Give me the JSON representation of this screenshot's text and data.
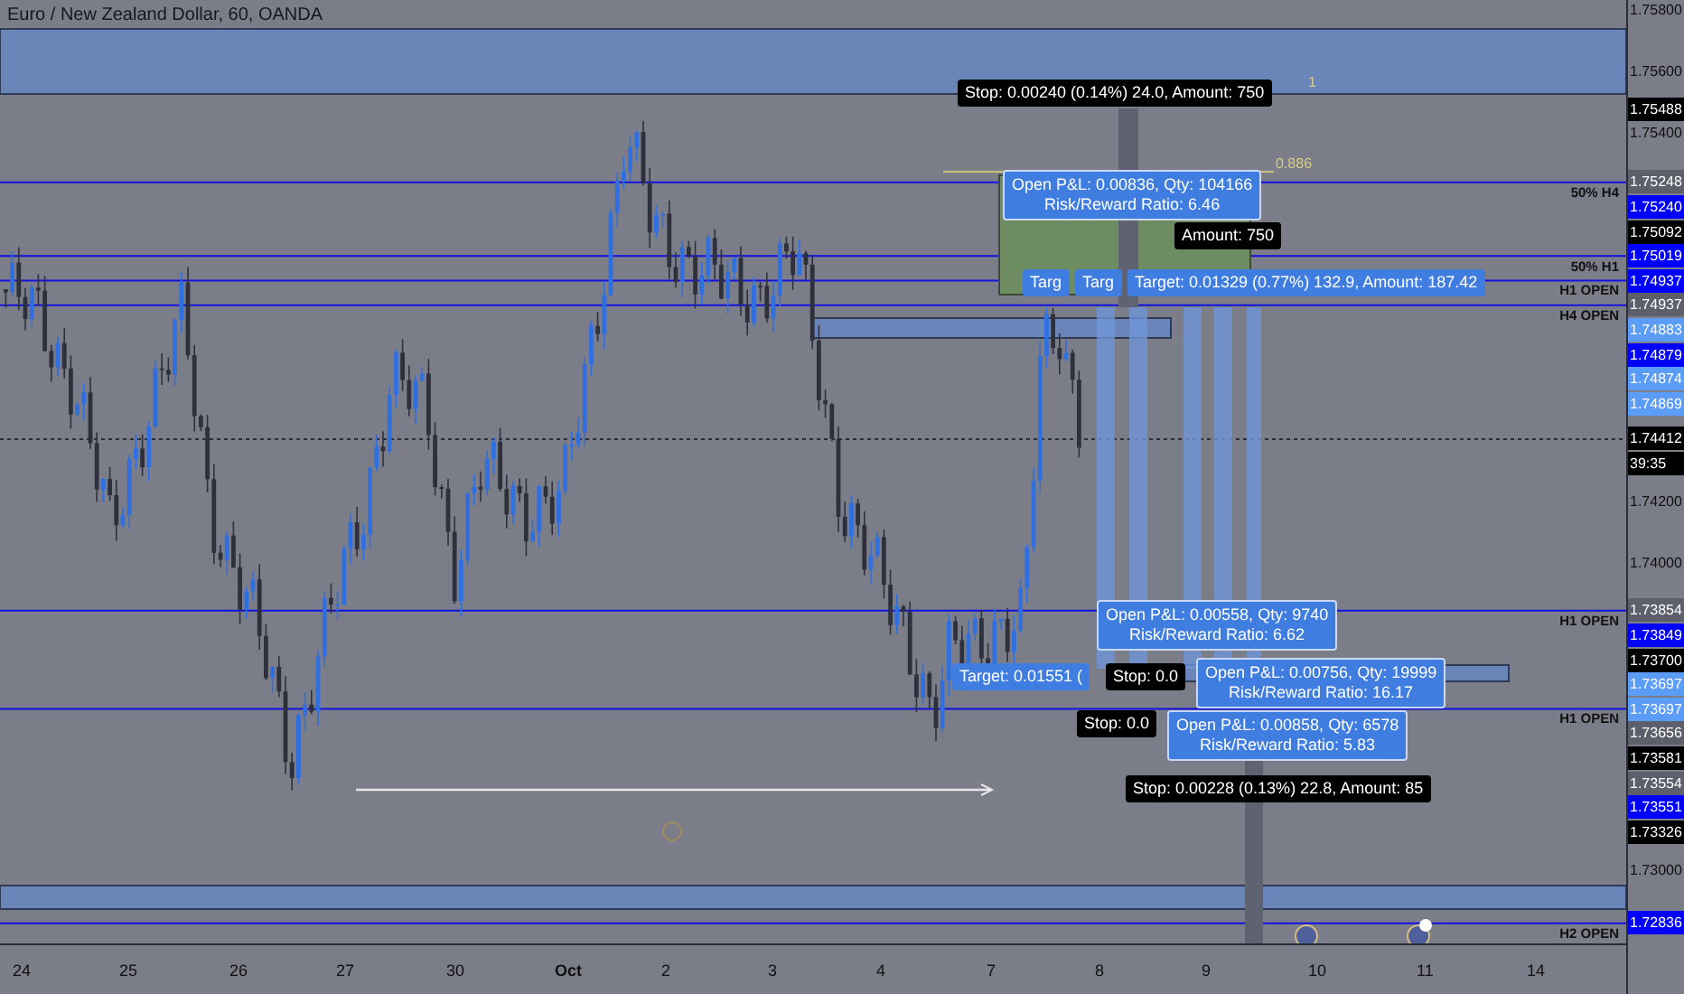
{
  "title": "Euro / New Zealand Dollar, 60, OANDA",
  "price_ticks": [
    "1.75800",
    "1.75600",
    "1.75400",
    "1.74200",
    "1.74000",
    "1.73000"
  ],
  "price_tags": [
    {
      "text": "1.75488",
      "kind": "black"
    },
    {
      "text": "1.75248",
      "kind": "grey",
      "line_label": "50% H4"
    },
    {
      "text": "1.75240",
      "kind": "blue"
    },
    {
      "text": "1.75092",
      "kind": "black"
    },
    {
      "text": "1.75019",
      "kind": "blue",
      "line_label": "50% H1"
    },
    {
      "text": "1.74937",
      "kind": "blue",
      "line_label": "H1 OPEN"
    },
    {
      "text": "1.74937",
      "kind": "grey",
      "line_label": "H4 OPEN"
    },
    {
      "text": "1.74883",
      "kind": "light"
    },
    {
      "text": "1.74879",
      "kind": "blue"
    },
    {
      "text": "1.74874",
      "kind": "light"
    },
    {
      "text": "1.74869",
      "kind": "light"
    },
    {
      "text": "1.74412",
      "kind": "black"
    },
    {
      "text": "39:35",
      "kind": "black"
    },
    {
      "text": "1.73854",
      "kind": "grey",
      "line_label": "H1 OPEN"
    },
    {
      "text": "1.73849",
      "kind": "blue"
    },
    {
      "text": "1.73700",
      "kind": "black"
    },
    {
      "text": "1.73697",
      "kind": "light"
    },
    {
      "text": "1.73697",
      "kind": "light",
      "line_label": "H1 OPEN"
    },
    {
      "text": "1.73656",
      "kind": "grey"
    },
    {
      "text": "1.73581",
      "kind": "black"
    },
    {
      "text": "1.73554",
      "kind": "grey"
    },
    {
      "text": "1.73551",
      "kind": "blue"
    },
    {
      "text": "1.73326",
      "kind": "black"
    },
    {
      "text": "1.72836",
      "kind": "blue",
      "line_label": "H2 OPEN"
    }
  ],
  "time_axis": [
    "24",
    "25",
    "26",
    "27",
    "30",
    "Oct",
    "2",
    "3",
    "4",
    "7",
    "8",
    "9",
    "10",
    "11",
    "14"
  ],
  "fib_labels": [
    "1",
    "0.886"
  ],
  "position_labels": [
    {
      "kind": "stop",
      "lines": [
        "Stop: 0.00240 (0.14%) 24.0, Amount: 750"
      ]
    },
    {
      "kind": "pnl",
      "lines": [
        "Open P&L: 0.00836, Qty: 104166",
        "Risk/Reward Ratio: 6.46"
      ]
    },
    {
      "kind": "stop",
      "lines": [
        "Amount: 750"
      ]
    },
    {
      "kind": "target",
      "lines": [
        "Targ"
      ]
    },
    {
      "kind": "target",
      "lines": [
        "Targ"
      ]
    },
    {
      "kind": "target",
      "lines": [
        "Target: 0.01329 (0.77%) 132.9, Amount: 187.42"
      ]
    },
    {
      "kind": "pnl",
      "lines": [
        "Open P&L: 0.00558, Qty: 9740",
        "Risk/Reward Ratio: 6.62"
      ]
    },
    {
      "kind": "target",
      "lines": [
        "Target: 0.01551 ("
      ]
    },
    {
      "kind": "stop",
      "lines": [
        "Stop: 0.0"
      ]
    },
    {
      "kind": "pnl",
      "lines": [
        "Open P&L: 0.00756, Qty: 19999",
        "Risk/Reward Ratio: 16.17"
      ]
    },
    {
      "kind": "stop",
      "lines": [
        "Stop: 0.0"
      ]
    },
    {
      "kind": "pnl",
      "lines": [
        "Open P&L: 0.00858, Qty: 6578",
        "Risk/Reward Ratio: 5.83"
      ]
    },
    {
      "kind": "stop",
      "lines": [
        "Stop: 0.00228 (0.13%) 22.8, Amount: 85"
      ]
    }
  ]
}
